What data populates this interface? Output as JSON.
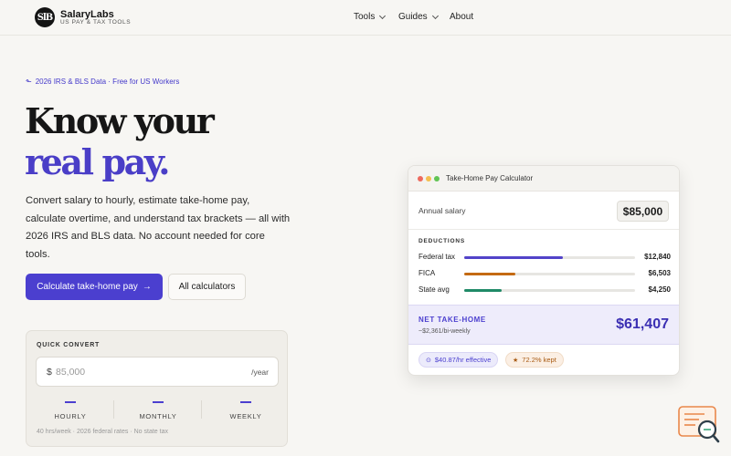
{
  "brand": {
    "mark": "SlB",
    "name": "SalaryLabs",
    "tagline": "US PAY & TAX TOOLS"
  },
  "nav": {
    "tools": "Tools",
    "guides": "Guides",
    "about": "About"
  },
  "hero": {
    "eyebrow": "2026 IRS & BLS Data · Free for US Workers",
    "title_line1": "Know your",
    "title_line2": "real pay.",
    "description": "Convert salary to hourly, estimate take-home pay, calculate overtime, and understand tax brackets — all with 2026 IRS and BLS data. No account needed for core tools.",
    "primary_cta": "Calculate take-home pay",
    "primary_cta_arrow": "→",
    "secondary_cta": "All calculators"
  },
  "quick_convert": {
    "title": "QUICK CONVERT",
    "currency_symbol": "$",
    "placeholder": "85,000",
    "unit": "/year",
    "columns": [
      {
        "label": "HOURLY",
        "value": "—"
      },
      {
        "label": "MONTHLY",
        "value": "—"
      },
      {
        "label": "WEEKLY",
        "value": "—"
      }
    ],
    "footnote": "40 hrs/week · 2026 federal rates · No state tax"
  },
  "calculator": {
    "title": "Take-Home Pay Calculator",
    "salary_label": "Annual salary",
    "salary_value": "$85,000",
    "deductions_title": "DEDUCTIONS",
    "deductions": [
      {
        "name": "Federal tax",
        "amount": "$12,840",
        "fraction": 0.58,
        "color": "#5243c9"
      },
      {
        "name": "FICA",
        "amount": "$6,503",
        "fraction": 0.3,
        "color": "#c46a12"
      },
      {
        "name": "State avg",
        "amount": "$4,250",
        "fraction": 0.22,
        "color": "#1f8a67"
      }
    ],
    "net_title": "NET TAKE-HOME",
    "net_sub": "~$2,361/bi-weekly",
    "net_value": "$61,407",
    "pill_effective": "$40.87/hr effective",
    "pill_kept": "72.2% kept"
  },
  "colors": {
    "accent": "#4b3fcf",
    "background": "#f7f6f3"
  }
}
